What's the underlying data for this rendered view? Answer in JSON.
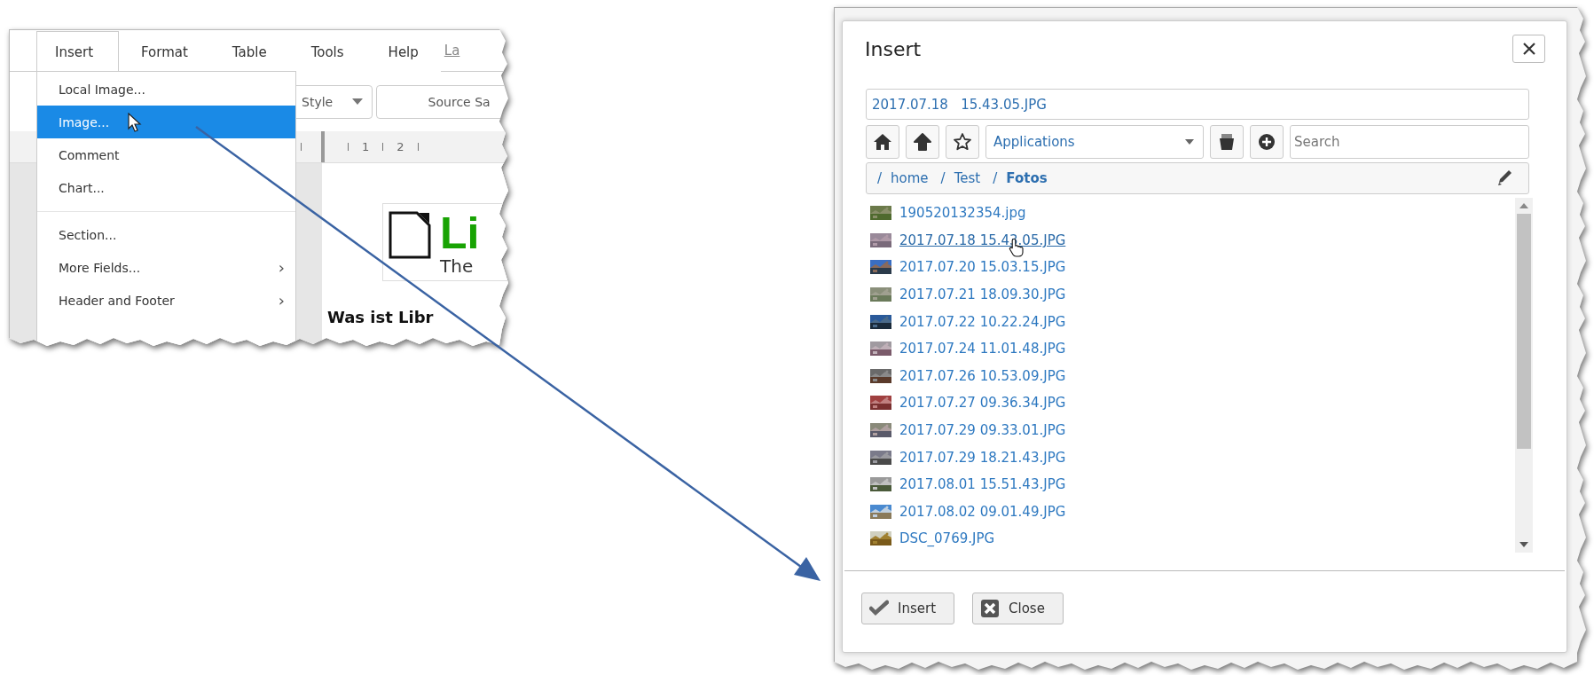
{
  "editor": {
    "menu_tabs": [
      {
        "label": "Insert",
        "selected": true
      },
      {
        "label": "Format",
        "selected": false
      },
      {
        "label": "Table",
        "selected": false
      },
      {
        "label": "Tools",
        "selected": false
      },
      {
        "label": "Help",
        "selected": false
      }
    ],
    "menu_link": "La",
    "toolbar": {
      "style_select": "Style",
      "font_select": "Source Sa"
    },
    "ruler_marks": [
      "1",
      "2"
    ],
    "insert_menu": [
      {
        "kind": "item",
        "label": "Local Image...",
        "selected": false
      },
      {
        "kind": "item",
        "label": "Image...",
        "selected": true
      },
      {
        "kind": "item",
        "label": "Comment",
        "selected": false
      },
      {
        "kind": "item",
        "label": "Chart...",
        "selected": false
      },
      {
        "kind": "separator"
      },
      {
        "kind": "item",
        "label": "Section...",
        "selected": false
      },
      {
        "kind": "item",
        "label": "More Fields...",
        "selected": false,
        "submenu": "›"
      },
      {
        "kind": "item",
        "label": "Header and Footer",
        "selected": false,
        "submenu": "›"
      }
    ],
    "document": {
      "logo_title": "Li",
      "logo_subtitle": "The",
      "heading": "Was ist Libr"
    }
  },
  "dialog": {
    "title": "Insert",
    "filename": "2017.07.18   15.43.05.JPG",
    "location_select": "Applications",
    "search": {
      "placeholder": "Search"
    },
    "breadcrumb": [
      {
        "separator": "/",
        "label": "home",
        "current": false
      },
      {
        "separator": "/",
        "label": "Test",
        "current": false
      },
      {
        "separator": "/",
        "label": "Fotos",
        "current": true
      }
    ],
    "files": [
      {
        "name": "190520132354.jpg",
        "hovered": false
      },
      {
        "name": "2017.07.18 15.43.05.JPG",
        "hovered": true
      },
      {
        "name": "2017.07.20 15.03.15.JPG",
        "hovered": false
      },
      {
        "name": "2017.07.21 18.09.30.JPG",
        "hovered": false
      },
      {
        "name": "2017.07.22 10.22.24.JPG",
        "hovered": false
      },
      {
        "name": "2017.07.24 11.01.48.JPG",
        "hovered": false
      },
      {
        "name": "2017.07.26 10.53.09.JPG",
        "hovered": false
      },
      {
        "name": "2017.07.27 09.36.34.JPG",
        "hovered": false
      },
      {
        "name": "2017.07.29 09.33.01.JPG",
        "hovered": false
      },
      {
        "name": "2017.07.29 18.21.43.JPG",
        "hovered": false
      },
      {
        "name": "2017.08.01 15.51.43.JPG",
        "hovered": false
      },
      {
        "name": "2017.08.02 09.01.49.JPG",
        "hovered": false
      },
      {
        "name": "DSC_0769.JPG",
        "hovered": false
      }
    ],
    "buttons": [
      {
        "kind": "confirm",
        "label": "Insert"
      },
      {
        "kind": "close",
        "label": "Close"
      }
    ]
  }
}
